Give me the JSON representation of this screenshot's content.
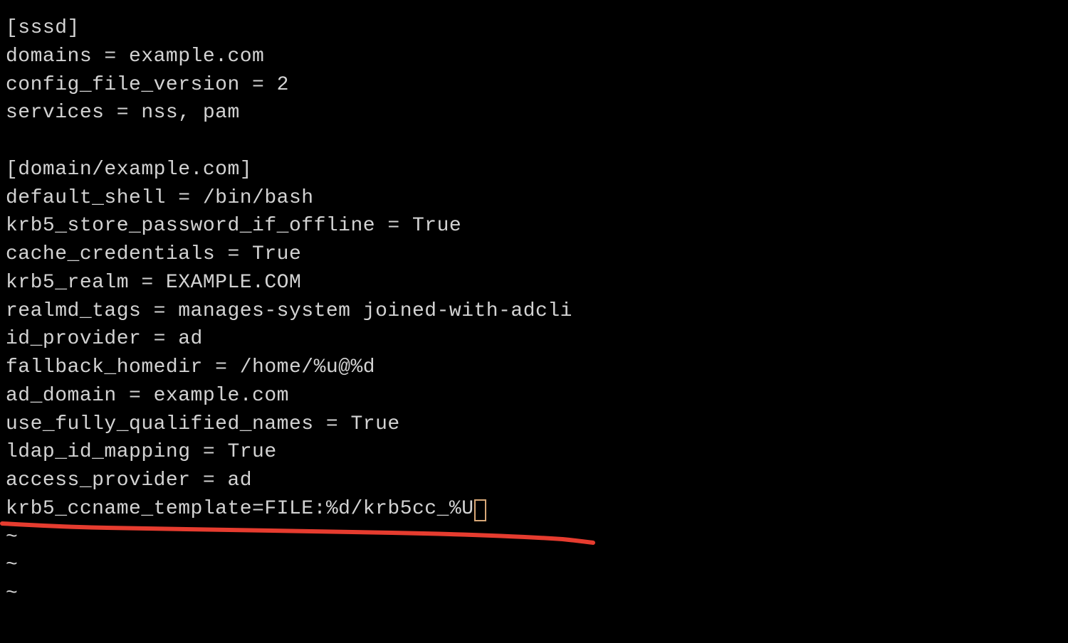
{
  "editor": {
    "lines": [
      "[sssd]",
      "domains = example.com",
      "config_file_version = 2",
      "services = nss, pam",
      "",
      "[domain/example.com]",
      "default_shell = /bin/bash",
      "krb5_store_password_if_offline = True",
      "cache_credentials = True",
      "krb5_realm = EXAMPLE.COM",
      "realmd_tags = manages-system joined-with-adcli",
      "id_provider = ad",
      "fallback_homedir = /home/%u@%d",
      "ad_domain = example.com",
      "use_fully_qualified_names = True",
      "ldap_id_mapping = True",
      "access_provider = ad"
    ],
    "cursor_line": "krb5_ccname_template=FILE:%d/krb5cc_%U",
    "tilde": "~",
    "tilde_count": 3
  },
  "annotation": {
    "color": "#e63c2f",
    "stroke_width": 6
  }
}
